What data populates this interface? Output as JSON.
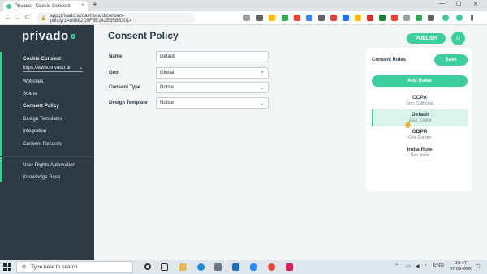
{
  "browser": {
    "tab_title": "Privado - Cookie Consent",
    "tab_close": "×",
    "new_tab": "+",
    "url": "app.privado.ai/dashboard/consent-policy/1A88882D9F5E142E958B3014",
    "back": "←",
    "forward": "→",
    "reload": "C",
    "lock": "🔒",
    "minimize": "—",
    "maximize": "☐",
    "close": "✕"
  },
  "sidebar": {
    "logo": "privado",
    "cookie_consent": "Cookie Consent",
    "domain": "https://www.privado.ai",
    "domain_chevron": "⌄",
    "items": [
      {
        "label": "Websites"
      },
      {
        "label": "Scans"
      },
      {
        "label": "Consent Policy"
      },
      {
        "label": "Design Templates"
      },
      {
        "label": "Integration"
      },
      {
        "label": "Consent Records"
      }
    ],
    "bottom_items": [
      {
        "label": "User Rights Automation"
      },
      {
        "label": "Knowledge Base"
      }
    ]
  },
  "header": {
    "title": "Consent Policy",
    "publish": "PUBLISH",
    "avatar": "U"
  },
  "form": {
    "name_label": "Name",
    "name_value": "Default",
    "geo_label": "Geo",
    "geo_value": "Global",
    "geo_clear": "×",
    "consent_type_label": "Consent Type",
    "consent_type_value": "Notice",
    "design_template_label": "Design Template",
    "design_template_value": "Notice",
    "chevron": "⌄"
  },
  "rules_panel": {
    "title": "Consent Rules",
    "save": "Save",
    "add_rules": "Add Rules",
    "rules": [
      {
        "name": "CCPA",
        "geo": "Geo: California"
      },
      {
        "name": "Default",
        "geo": "Geo: Global"
      },
      {
        "name": "GDPR",
        "geo": "Geo: Europe"
      },
      {
        "name": "India Rule",
        "geo": "Geo: India"
      }
    ]
  },
  "taskbar": {
    "search_placeholder": "Type here to search",
    "search_icon": "⚲",
    "lang": "ENG",
    "time": "10:47",
    "date": "07-09-2020"
  },
  "colors": {
    "accent": "#3ccf9c",
    "sidebar_bg": "#2d3b47",
    "main_bg": "#f1f5f5"
  }
}
